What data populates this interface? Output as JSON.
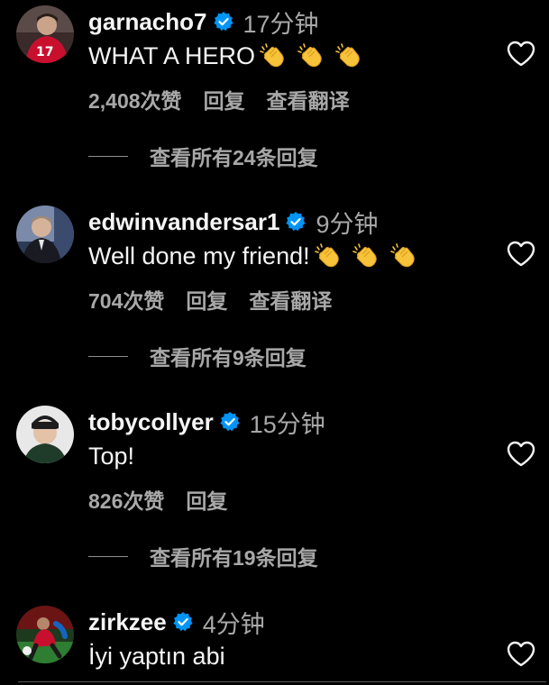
{
  "colors": {
    "background": "#000000",
    "text_primary": "#f5f5f5",
    "text_secondary": "#a8a8a8",
    "verified_badge": "#0095f6"
  },
  "icons": {
    "verified": "verified-badge-icon",
    "like": "heart-outline-icon",
    "emoji": "clapping-hands-emoji"
  },
  "comments": [
    {
      "username": "garnacho7",
      "time": "17分钟",
      "text": "WHAT A HERO",
      "emoji_count": 3,
      "likes": "2,408次赞",
      "reply": "回复",
      "translate": "查看翻译",
      "view_replies": "查看所有24条回复"
    },
    {
      "username": "edwinvandersar1",
      "time": "9分钟",
      "text": "Well done my friend!",
      "emoji_count": 3,
      "likes": "704次赞",
      "reply": "回复",
      "translate": "查看翻译",
      "view_replies": "查看所有9条回复"
    },
    {
      "username": "tobycollyer",
      "time": "15分钟",
      "text": "Top!",
      "emoji_count": 0,
      "likes": "826次赞",
      "reply": "回复",
      "view_replies": "查看所有19条回复"
    },
    {
      "username": "zirkzee",
      "time": "4分钟",
      "text": "İyi yaptın abi",
      "emoji_count": 0
    }
  ]
}
